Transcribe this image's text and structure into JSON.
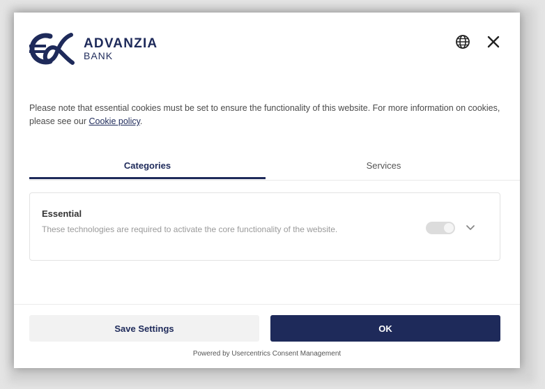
{
  "brand": {
    "name": "ADVANZIA",
    "sub": "BANK",
    "color": "#1e2a5a"
  },
  "header": {
    "language_icon": "globe-icon",
    "close_icon": "close-icon"
  },
  "intro": {
    "text": "Please note that essential cookies must be set to ensure the functionality of this website. For more information on cookies, please see our",
    "link_label": "Cookie policy",
    "trailing": "."
  },
  "tabs": [
    {
      "label": "Categories",
      "active": true
    },
    {
      "label": "Services",
      "active": false
    }
  ],
  "categories": [
    {
      "title": "Essential",
      "description": "These technologies are required to activate the core functionality of the website.",
      "toggle_on": true,
      "toggle_disabled": true,
      "expand_icon": "chevron-down-icon"
    }
  ],
  "buttons": {
    "save_label": "Save Settings",
    "ok_label": "OK"
  },
  "footer": {
    "powered_by": "Powered by Usercentrics Consent Management"
  },
  "colors": {
    "primary": "#1e2a5a",
    "secondary_button": "#f2f2f2",
    "toggle_disabled": "#dcdcdc"
  }
}
